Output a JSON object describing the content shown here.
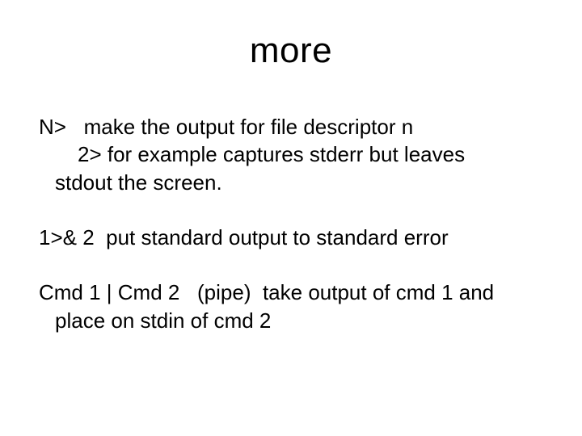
{
  "slide": {
    "title": "more",
    "p1_line1": "N>   make the output for file descriptor n",
    "p1_line2": "2> for example captures stderr but leaves",
    "p1_line3": "stdout the screen.",
    "p2": "1>& 2  put standard output to standard error",
    "p3_line1": "Cmd 1 | Cmd 2   (pipe)  take output of cmd 1 and",
    "p3_line2": "place on stdin of cmd 2"
  }
}
